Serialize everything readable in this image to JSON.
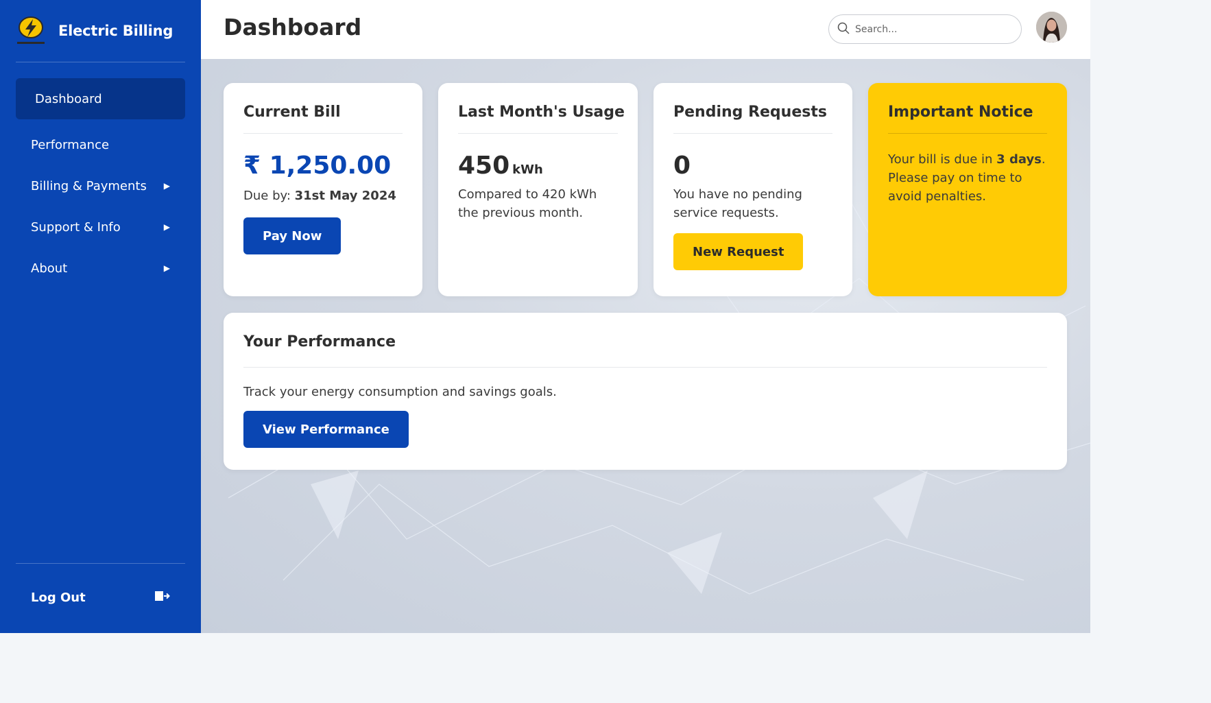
{
  "sidebar": {
    "brand": "Electric Billing",
    "items": [
      {
        "label": "Dashboard",
        "active": true
      },
      {
        "label": "Performance"
      },
      {
        "label": "Billing & Payments",
        "has_submenu": true
      },
      {
        "label": "Support & Info",
        "has_submenu": true
      },
      {
        "label": "About",
        "has_submenu": true
      }
    ],
    "logout": "Log Out"
  },
  "header": {
    "title": "Dashboard",
    "search_placeholder": "Search..."
  },
  "cards": {
    "current_bill": {
      "title": "Current Bill",
      "amount": "₹ 1,250.00",
      "due_label": "Due by: ",
      "due_date": "31st May 2024",
      "button": "Pay Now"
    },
    "usage": {
      "title": "Last Month's Usage",
      "value": "450",
      "unit": "kWh",
      "desc": "Compared to 420 kWh the previous month."
    },
    "pending": {
      "title": "Pending Requests",
      "value": "0",
      "desc": "You have no pending service requests.",
      "button": "New Request"
    },
    "notice": {
      "title": "Important Notice",
      "text_before": "Your bill is due in ",
      "highlight": "3 days",
      "text_after": ". Please pay on time to avoid penalties."
    },
    "performance": {
      "title": "Your Performance",
      "desc": "Track your energy consumption and savings goals.",
      "button": "View Performance"
    }
  },
  "colors": {
    "primary": "#0a46b3",
    "primary_dark": "#06348a",
    "accent": "#ffcb05"
  }
}
